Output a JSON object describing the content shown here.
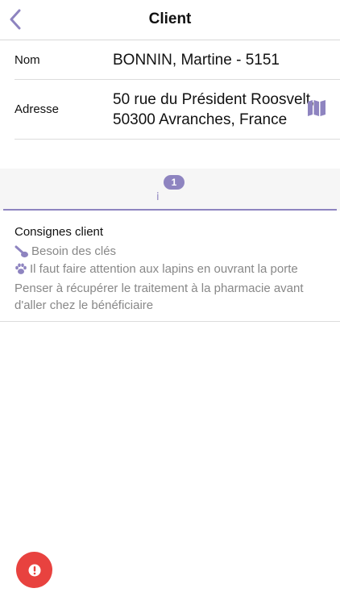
{
  "header": {
    "title": "Client"
  },
  "client": {
    "name_label": "Nom",
    "name_value": "BONNIN, Martine - 5151",
    "address_label": "Adresse",
    "address_value": "50 rue du Président Roosvelt, 50300 Avranches, France"
  },
  "tabs": {
    "info_symbol": "i",
    "info_badge": "1"
  },
  "consignes": {
    "title": "Consignes client",
    "key_text": "Besoin des clés",
    "pet_text": "Il faut faire attention aux lapins en ouvrant la porte",
    "note": "Penser à récupérer le traitement à la pharmacie avant d'aller chez le bénéficiaire"
  },
  "colors": {
    "accent": "#8e84c0",
    "alert": "#e8423f",
    "muted_text": "#888888"
  },
  "icons": {
    "back": "chevron-left-icon",
    "map": "map-icon",
    "key": "key-icon",
    "paw": "paw-icon",
    "alert": "exclamation-icon"
  }
}
